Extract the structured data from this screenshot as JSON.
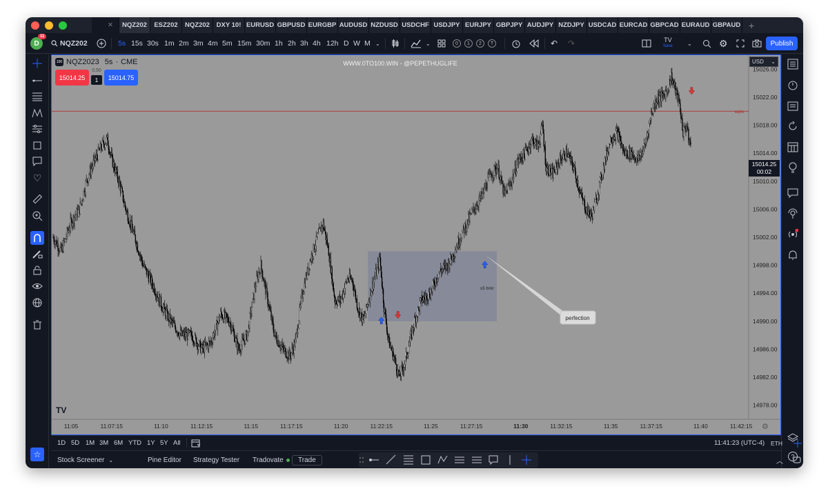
{
  "window": {
    "traffic_colors": [
      "#ff5f57",
      "#febc2e",
      "#28c840"
    ]
  },
  "tabs": [
    "NQZ202",
    "ESZ202",
    "NQZ202",
    "DXY 10!",
    "EURUSD",
    "GBPUSD",
    "EURGBP",
    "AUDUSD",
    "NZDUSD",
    "USDCHF",
    "USDJPY",
    "EURJPY",
    "GBPJPY",
    "AUDJPY",
    "NZDJPY",
    "USDCAD",
    "EURCAD",
    "GBPCAD",
    "EURAUD",
    "GBPAUD"
  ],
  "toolbar": {
    "avatar_letter": "D",
    "notification_count": "11",
    "symbol": "NQZ202",
    "timeframes": [
      "5s",
      "15s",
      "30s",
      "1m",
      "2m",
      "3m",
      "4m",
      "5m",
      "15m",
      "30m",
      "1h",
      "2h",
      "3h",
      "4h",
      "12h",
      "D",
      "W",
      "M"
    ],
    "active_timeframe": "5s",
    "alert_circles": [
      "0",
      "1",
      "2",
      "T"
    ],
    "tv_label": "TV",
    "save_label": "Save",
    "publish_label": "Publish"
  },
  "chart": {
    "symbol_title": "NQZ2023",
    "interval": "5s",
    "exchange": "CME",
    "symbol_logo": "100",
    "watermark": "WWW.0TO100.WIN  -  @PEPETHUGLIFE",
    "sell_price": "15014.25",
    "buy_price": "15014.75",
    "spread": "0.50",
    "quantity": "1",
    "currency": "USD",
    "current_price": "15014.25",
    "countdown": "00:02",
    "eqhs_label": "eqhs",
    "box_label": "s5 brkr",
    "callout_label": "perfection",
    "tv_logo": "TV"
  },
  "chart_data": {
    "type": "candlestick",
    "price_axis": [
      "15026.00",
      "15022.00",
      "15018.00",
      "15014.00",
      "15010.00",
      "15006.00",
      "15002.00",
      "14998.00",
      "14994.00",
      "14990.00",
      "14986.00",
      "14982.00",
      "14978.00"
    ],
    "time_axis": [
      "11:05",
      "11:07:15",
      "11:10",
      "11:12:15",
      "11:15",
      "11:17:15",
      "11:20",
      "11:22:15",
      "11:25",
      "11:27:15",
      "11:30",
      "11:32:15",
      "11:35",
      "11:37:15",
      "11:40",
      "11:42:15"
    ],
    "ylim": [
      14976,
      15028
    ],
    "horizontal_line": {
      "price": 15020,
      "label": "eqhs",
      "color": "#b22222"
    },
    "path": [
      [
        0,
        15002
      ],
      [
        12,
        15000
      ],
      [
        25,
        15004
      ],
      [
        38,
        15006
      ],
      [
        48,
        15010
      ],
      [
        60,
        15013
      ],
      [
        70,
        15015
      ],
      [
        78,
        15016
      ],
      [
        85,
        15013
      ],
      [
        95,
        15010
      ],
      [
        105,
        15006
      ],
      [
        118,
        15002
      ],
      [
        130,
        14998
      ],
      [
        145,
        14995
      ],
      [
        158,
        14992
      ],
      [
        170,
        14990
      ],
      [
        185,
        14988
      ],
      [
        200,
        14988
      ],
      [
        215,
        14986
      ],
      [
        228,
        14987
      ],
      [
        242,
        14991
      ],
      [
        255,
        14990
      ],
      [
        268,
        14986
      ],
      [
        280,
        14988
      ],
      [
        292,
        14995
      ],
      [
        300,
        14998
      ],
      [
        310,
        14993
      ],
      [
        320,
        14988
      ],
      [
        332,
        14986
      ],
      [
        342,
        14985
      ],
      [
        350,
        14987
      ],
      [
        360,
        14994
      ],
      [
        372,
        14999
      ],
      [
        382,
        15002
      ],
      [
        390,
        15004
      ],
      [
        398,
        15000
      ],
      [
        407,
        14993
      ],
      [
        415,
        14993
      ],
      [
        425,
        14996
      ],
      [
        432,
        14996
      ],
      [
        440,
        14992
      ],
      [
        448,
        14990
      ],
      [
        458,
        14994
      ],
      [
        467,
        14997
      ],
      [
        472,
        14999
      ],
      [
        478,
        14992
      ],
      [
        485,
        14987
      ],
      [
        492,
        14985
      ],
      [
        500,
        14982
      ],
      [
        508,
        14984
      ],
      [
        515,
        14987
      ],
      [
        522,
        14990
      ],
      [
        532,
        14993
      ],
      [
        545,
        14994
      ],
      [
        557,
        14997
      ],
      [
        570,
        14998
      ],
      [
        580,
        15000
      ],
      [
        588,
        15002
      ],
      [
        598,
        15004
      ],
      [
        608,
        15006
      ],
      [
        620,
        15008
      ],
      [
        632,
        15011
      ],
      [
        642,
        15012
      ],
      [
        652,
        15008
      ],
      [
        662,
        15010
      ],
      [
        672,
        15013
      ],
      [
        682,
        15014
      ],
      [
        692,
        15016
      ],
      [
        700,
        15015
      ],
      [
        707,
        15018
      ],
      [
        712,
        15012
      ],
      [
        722,
        15011
      ],
      [
        732,
        15013
      ],
      [
        742,
        15014
      ],
      [
        752,
        15012
      ],
      [
        762,
        15008
      ],
      [
        770,
        15006
      ],
      [
        778,
        15005
      ],
      [
        786,
        15008
      ],
      [
        795,
        15012
      ],
      [
        805,
        15016
      ],
      [
        815,
        15017
      ],
      [
        825,
        15014
      ],
      [
        835,
        15014
      ],
      [
        845,
        15013
      ],
      [
        855,
        15015
      ],
      [
        865,
        15020
      ],
      [
        873,
        15022
      ],
      [
        880,
        15022
      ],
      [
        887,
        15023
      ],
      [
        893,
        15025
      ],
      [
        899,
        15023
      ],
      [
        905,
        15021
      ],
      [
        910,
        15017
      ],
      [
        915,
        15018
      ],
      [
        918,
        15016
      ],
      [
        922,
        15015
      ]
    ],
    "zone": {
      "x_start": "11:21:30",
      "x_end": "11:28:40",
      "y_top": 15000,
      "y_bottom": 14990
    },
    "markers": [
      {
        "type": "up-arrow",
        "time": "11:22:15",
        "price": 14990
      },
      {
        "type": "down-arrow",
        "time": "11:23:10",
        "price": 14991
      },
      {
        "type": "up-arrow",
        "time": "11:28:00",
        "price": 14998
      },
      {
        "type": "down-arrow",
        "time": "11:39:30",
        "price": 15023
      }
    ]
  },
  "bottom_timeframes": [
    "1D",
    "5D",
    "1M",
    "3M",
    "6M",
    "YTD",
    "1Y",
    "5Y",
    "All"
  ],
  "status": {
    "clock": "11:41:23 (UTC-4)",
    "mode": "ETH"
  },
  "bottom_panel": {
    "items": [
      "Stock Screener",
      "Pine Editor",
      "Strategy Tester",
      "Tradovate",
      "Trade"
    ]
  }
}
